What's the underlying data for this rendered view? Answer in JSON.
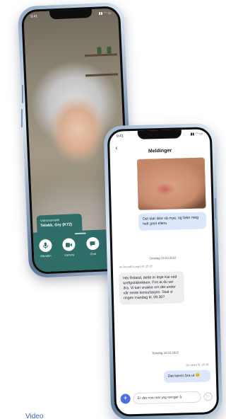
{
  "video_call": {
    "status_time": "9:41",
    "status_icons": "▮▮ ◠ ▭",
    "callout_label": "Videosamtale",
    "callout_name": "Telokk, Gry (K72)",
    "controls": [
      {
        "label": "Mikrofon",
        "icon": "mic-icon"
      },
      {
        "label": "Kamera",
        "icon": "camera-icon"
      },
      {
        "label": "Chat",
        "icon": "chat-icon"
      },
      {
        "label": "",
        "icon": "end-call-icon"
      }
    ]
  },
  "messages": {
    "status_time": "9:41",
    "status_icons": "▮▮ ◠ ▭",
    "title": "Meldinger",
    "bubble_1": "Det klør ikke så mye, og føler meg helt greit ellers.",
    "date_1": "Onsdag 23.03.2022",
    "meta_in": "Av Brendil (Lege) kl. 10:22",
    "bubble_2": "Hei Roland, dette er lege Kai ved kreftpoliklinikken. Fint at du ser ifra. Vi kan snakke om det under vår neste konsultasjon. Skal vi ringes mandag kl. 09.30?",
    "date_2": "Torsdag 24.03.2022",
    "meta_out": "Du skrev kl. 10:16",
    "bubble_3": "Det høres bra ut 😊",
    "input_placeholder": "Er det noe mer jeg trenger å",
    "send_icon": "send-icon"
  },
  "caption": "Video"
}
